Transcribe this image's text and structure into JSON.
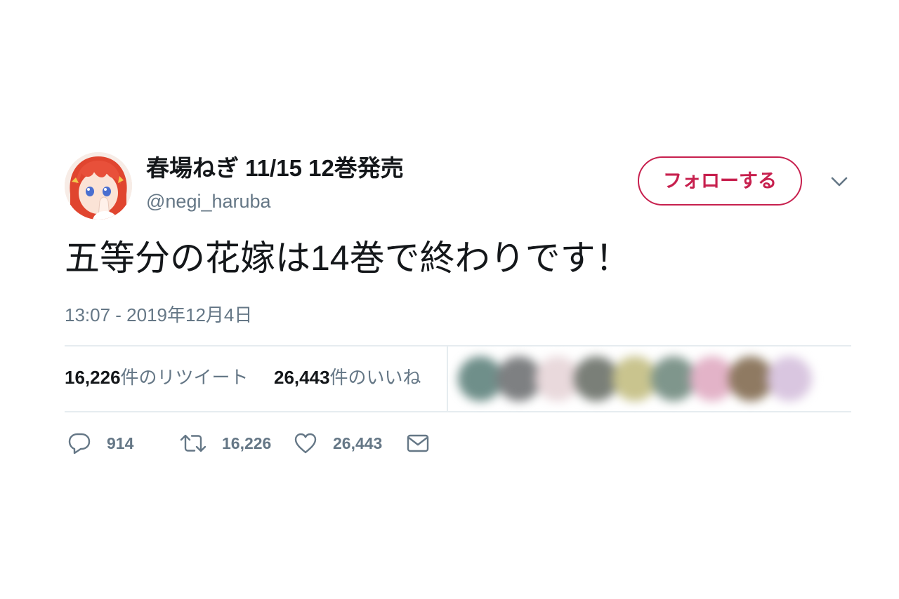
{
  "user": {
    "display_name": "春場ねぎ 11/15 12巻発売",
    "handle": "@negi_haruba"
  },
  "follow_button": {
    "label": "フォローする",
    "color": "#c7204e"
  },
  "tweet": {
    "text": "五等分の花嫁は14巻で終わりです！",
    "timestamp": "13:07 - 2019年12月4日"
  },
  "stats": {
    "retweets_count": "16,226",
    "retweets_label": "件のリツイート",
    "likes_count": "26,443",
    "likes_label": "件のいいね"
  },
  "liker_avatar_colors": [
    "#6f8f8a",
    "#7e8082",
    "#e9d9dc",
    "#7a7f78",
    "#c9c48e",
    "#7f968c",
    "#e3b3c8",
    "#8f7a62",
    "#d9c6e0"
  ],
  "actions": {
    "reply_count": "914",
    "retweet_count": "16,226",
    "like_count": "26,443"
  },
  "icons": {
    "reply": "reply-icon",
    "retweet": "retweet-icon",
    "like": "heart-icon",
    "dm": "envelope-icon",
    "caret": "chevron-down-icon"
  }
}
